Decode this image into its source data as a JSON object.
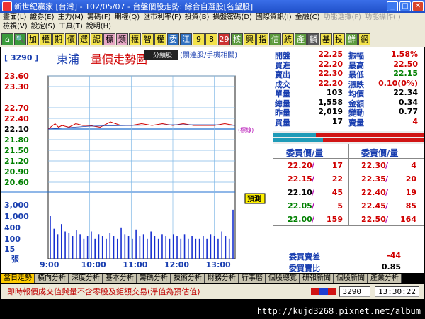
{
  "window": {
    "title": "新世紀贏家 [台灣] - 102/05/07 - 台盤個股走勢: 綜合自選股[名望股]"
  },
  "menu": {
    "row1": [
      "畫面(L)",
      "證券(E)",
      "主力(M)",
      "籌碼(F)",
      "期權(Q)",
      "匯市利率(F)",
      "投資(B)",
      "操盤密碼(D)",
      "國際資訊(I)",
      "金融(C)",
      "功能選擇(F)",
      "功能操作(I)"
    ],
    "row2": [
      "檢視(V)",
      "設定(S)",
      "工具(T)",
      "說明(H)"
    ]
  },
  "toolbar": {
    "buttons": [
      "加",
      "權",
      "期",
      "價",
      "選",
      "認",
      "標",
      "類",
      "權",
      "智",
      "權",
      "委",
      "江",
      "9",
      "8",
      "29",
      "核",
      "興",
      "指",
      "信",
      "統",
      "產",
      "麟",
      "基",
      "投",
      "鮮",
      "網"
    ]
  },
  "chart": {
    "stock_code": "3290",
    "stock_name": "東浦",
    "title": "量價走勢圖",
    "popup_label": "分類股",
    "link_text": "(關連股/手機相關)",
    "mark_label": "(標線)",
    "forecast_label": "預測",
    "volume_unit": "張"
  },
  "chart_data": [
    {
      "type": "line",
      "title": "量價走勢圖",
      "ylim": [
        20.6,
        23.6
      ],
      "yticks": [
        "23.60",
        "23.30",
        "22.70",
        "22.40",
        "22.10",
        "21.80",
        "21.50",
        "21.20",
        "20.90",
        "20.60"
      ],
      "xticks": [
        "9:00",
        "10:00",
        "11:00",
        "12:00",
        "13:00"
      ],
      "reference_price": 22.1,
      "series": [
        {
          "x": [
            "9:00",
            "9:10",
            "9:15",
            "9:20",
            "9:30",
            "9:40",
            "9:50",
            "10:00",
            "10:15",
            "10:30",
            "10:45",
            "11:00",
            "11:15",
            "11:30",
            "11:45",
            "12:00",
            "12:15",
            "12:30",
            "12:45",
            "13:00",
            "13:15",
            "13:30"
          ],
          "values": [
            22.1,
            22.25,
            22.15,
            22.2,
            22.15,
            22.25,
            22.2,
            22.2,
            22.15,
            22.3,
            22.2,
            22.2,
            22.25,
            22.2,
            22.25,
            22.2,
            22.25,
            22.2,
            22.2,
            22.2,
            22.25,
            22.2
          ]
        },
        {
          "x": [
            "9:00",
            "10:00",
            "11:00",
            "12:00",
            "13:00",
            "13:30"
          ],
          "values": [
            22.1,
            22.18,
            22.2,
            22.22,
            22.22,
            22.2
          ]
        }
      ]
    },
    {
      "type": "bar",
      "title": "",
      "ylim": [
        0,
        4000
      ],
      "yticks": [
        "3,000",
        "1,000",
        "400",
        "100",
        "15"
      ],
      "values": [
        600,
        90,
        40,
        180,
        60,
        50,
        30,
        70,
        40,
        20,
        30,
        60,
        20,
        40,
        30,
        20,
        50,
        30,
        20,
        110,
        40,
        30,
        20,
        80,
        30,
        40,
        20,
        60,
        30,
        20,
        40,
        30,
        20,
        40,
        30,
        20,
        40,
        20,
        30,
        20,
        20,
        30,
        20,
        40,
        30,
        20,
        60,
        30,
        20,
        1558
      ]
    }
  ],
  "quote": {
    "left": [
      {
        "label": "開盤",
        "value": "22.25"
      },
      {
        "label": "買進",
        "value": "22.20"
      },
      {
        "label": "賣出",
        "value": "22.30"
      },
      {
        "label": "成交",
        "value": "22.20"
      },
      {
        "label": "單量",
        "value": "103"
      },
      {
        "label": "總量",
        "value": "1,558"
      },
      {
        "label": "昨量",
        "value": "2,019"
      },
      {
        "label": "買量",
        "value": "17"
      }
    ],
    "right": [
      {
        "label": "振幅",
        "value": "1.58%"
      },
      {
        "label": "最高",
        "value": "22.50"
      },
      {
        "label": "最低",
        "value": "22.15"
      },
      {
        "label": "漲跌",
        "value": "0.10(0%)"
      },
      {
        "label": "均價",
        "value": "22.34"
      },
      {
        "label": "金額",
        "value": "0.34"
      },
      {
        "label": "變動",
        "value": "0.77"
      },
      {
        "label": "賣量",
        "value": "4"
      }
    ]
  },
  "order_book": {
    "bid_header": "委買價/量",
    "ask_header": "委賣價/量",
    "bids": [
      {
        "price": "22.20",
        "qty": "17"
      },
      {
        "price": "22.15",
        "qty": "22"
      },
      {
        "price": "22.10",
        "qty": "45"
      },
      {
        "price": "22.05",
        "qty": "5"
      },
      {
        "price": "22.00",
        "qty": "159"
      }
    ],
    "asks": [
      {
        "price": "22.30",
        "qty": "4"
      },
      {
        "price": "22.35",
        "qty": "20"
      },
      {
        "price": "22.40",
        "qty": "19"
      },
      {
        "price": "22.45",
        "qty": "85"
      },
      {
        "price": "22.50",
        "qty": "164"
      }
    ],
    "diff_label": "委買賣差",
    "diff_value": "-44",
    "ratio_label": "委買賣比",
    "ratio_value": "0.85"
  },
  "tabs": [
    "當日走勢",
    "橫向分析",
    "深度分析",
    "基本分析",
    "籌碼分析",
    "技術分析",
    "財務分析",
    "行事曆",
    "個股總覽",
    "研報新聞",
    "個股新聞",
    "產業分析"
  ],
  "status": {
    "message": "即時報價成交值與量不含零股及鉅額交易(淨值為預估值)",
    "code": "3290",
    "time": "13:30:22"
  },
  "watermark": "http://kujd3268.pixnet.net/album",
  "colors": {
    "price_up": "#d00000",
    "price_down": "#008000",
    "label_blue": "#1a3fb0",
    "bar_blue": "#1830d0"
  }
}
